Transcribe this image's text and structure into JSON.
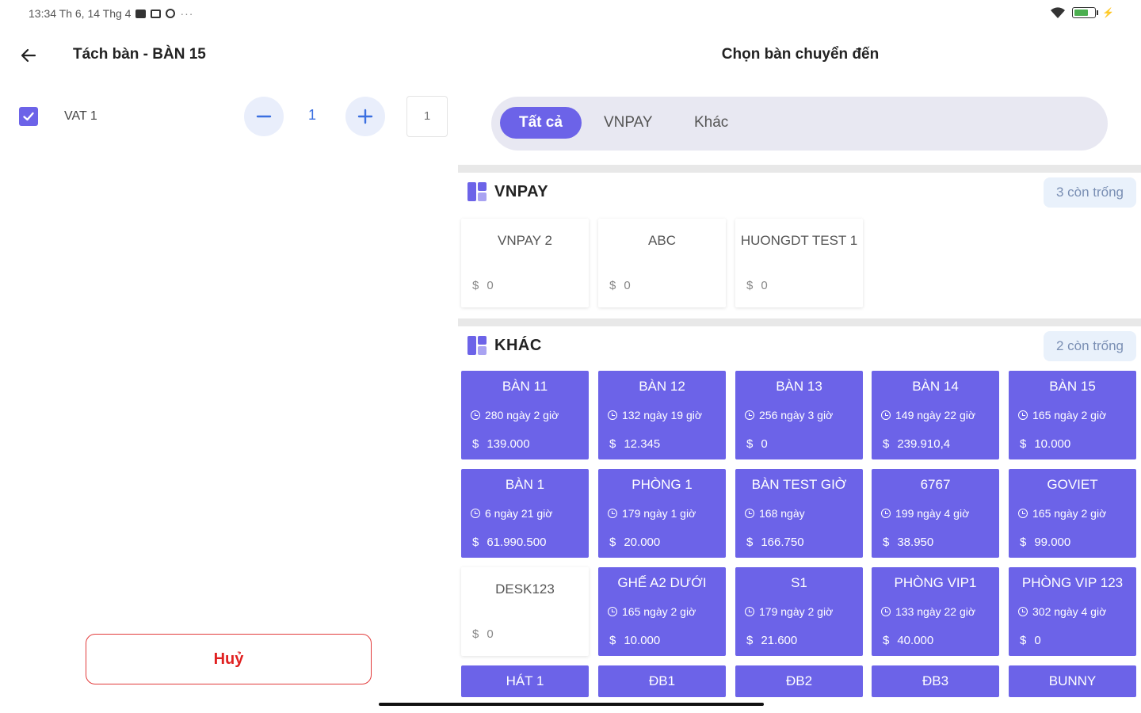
{
  "status": {
    "time": "13:34 Th 6, 14 Thg 4",
    "dots": "···",
    "battery_level": 0.6
  },
  "left": {
    "title": "Tách bàn - BÀN 15",
    "item": {
      "name": "VAT 1",
      "qty": "1",
      "input_value": "1",
      "checked": true
    },
    "cancel_label": "Huỷ"
  },
  "right": {
    "title": "Chọn bàn chuyển đến",
    "filters": [
      "Tất cả",
      "VNPAY",
      "Khác"
    ],
    "active_filter": "Tất cả",
    "sections": [
      {
        "name": "VNPAY",
        "badge": "3 còn trống",
        "tables": [
          {
            "name": "VNPAY 2",
            "amount": "0"
          },
          {
            "name": "ABC",
            "amount": "0"
          },
          {
            "name": "HUONGDT TEST 1",
            "amount": "0"
          }
        ]
      },
      {
        "name": "KHÁC",
        "badge": "2 còn trống",
        "tables": [
          {
            "name": "BÀN 11",
            "time": "280 ngày 2 giờ",
            "amount": "139.000"
          },
          {
            "name": "BÀN 12",
            "time": "132 ngày 19 giờ",
            "amount": "12.345"
          },
          {
            "name": "BÀN 13",
            "time": "256 ngày 3 giờ",
            "amount": "0"
          },
          {
            "name": "BÀN 14",
            "time": "149 ngày 22 giờ",
            "amount": "239.910,4"
          },
          {
            "name": "BÀN 15",
            "time": "165 ngày 2 giờ",
            "amount": "10.000"
          },
          {
            "name": "BÀN 1",
            "time": "6 ngày 21 giờ",
            "amount": "61.990.500"
          },
          {
            "name": "PHÒNG 1",
            "time": "179 ngày 1 giờ",
            "amount": "20.000"
          },
          {
            "name": "BÀN TEST GIỜ",
            "time": "168 ngày",
            "amount": "166.750"
          },
          {
            "name": "6767",
            "time": "199 ngày 4 giờ",
            "amount": "38.950"
          },
          {
            "name": "GOVIET",
            "time": "165 ngày 2 giờ",
            "amount": "99.000"
          },
          {
            "name": "DESK123",
            "amount": "0"
          },
          {
            "name": "GHẾ A2 DƯỚI",
            "time": "165 ngày 2 giờ",
            "amount": "10.000"
          },
          {
            "name": "S1",
            "time": "179 ngày 2 giờ",
            "amount": "21.600"
          },
          {
            "name": "PHÒNG VIP1",
            "time": "133 ngày 22 giờ",
            "amount": "40.000"
          },
          {
            "name": "PHÒNG VIP 123",
            "time": "302 ngày 4 giờ",
            "amount": "0"
          },
          {
            "name": "HÁT 1"
          },
          {
            "name": "ĐB1"
          },
          {
            "name": "ĐB2"
          },
          {
            "name": "ĐB3"
          },
          {
            "name": "BUNNY"
          }
        ]
      }
    ]
  },
  "colors": {
    "accent": "#6c63e8",
    "danger": "#e02020",
    "badge_bg": "#e9f1fb"
  },
  "icons": [
    "back-arrow-icon",
    "check-icon",
    "minus-icon",
    "plus-icon",
    "section-grid-icon",
    "clock-icon",
    "dollar-icon",
    "wifi-icon",
    "battery-icon"
  ]
}
